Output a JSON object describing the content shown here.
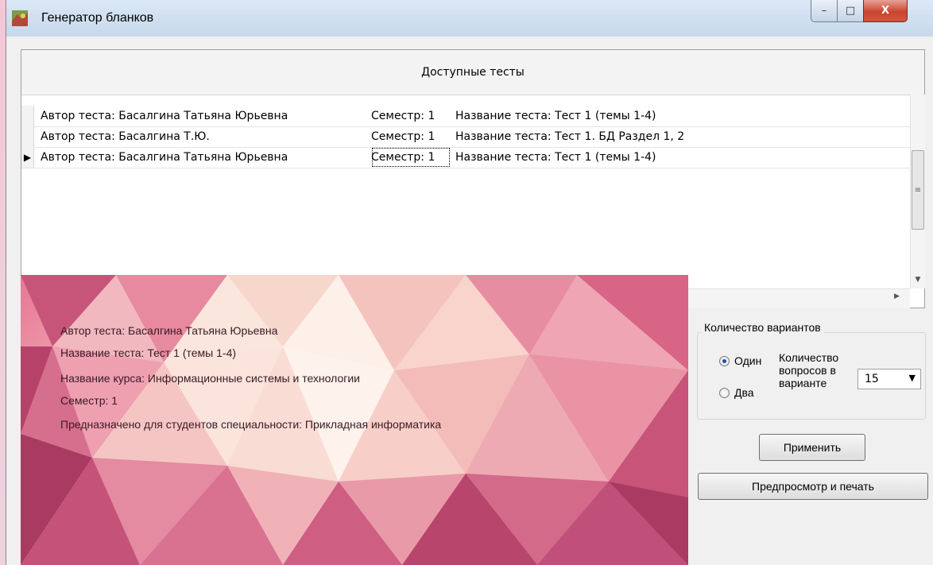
{
  "window": {
    "title": "Генератор бланков",
    "controls": {
      "minimize": "–",
      "maximize": "□",
      "close": "X"
    }
  },
  "tests_grid": {
    "caption": "Доступные тесты",
    "rows": [
      {
        "author": "Автор теста: Басалгина Татьяна Юрьевна",
        "semester": "Семестр: 1",
        "title": "Название теста: Тест 1 (темы 1-4)",
        "marker": ""
      },
      {
        "author": "Автор теста: Басалгина Т.Ю.",
        "semester": "Семестр: 1",
        "title": "Название теста:  Тест 1. БД Раздел 1, 2",
        "marker": ""
      },
      {
        "author": "Автор теста: Басалгина Татьяна Юрьевна",
        "semester": "Семестр: 1",
        "title": "Название теста: Тест 1 (темы 1-4)",
        "marker": "▶"
      }
    ]
  },
  "details": {
    "author": "Автор теста: Басалгина Татьяна Юрьевна",
    "test_name": "Название теста: Тест 1 (темы 1-4)",
    "course": "Название курса:  Информационные системы и технологии",
    "semester": "Семестр: 1",
    "audience": "Предназначено для студентов специальности: Прикладная информатика"
  },
  "variants": {
    "group_title": "Количество вариантов",
    "option_one": "Один",
    "option_two": "Два",
    "selected": "Один",
    "questions_label": "Количество вопросов в варианте",
    "questions_value": "15"
  },
  "buttons": {
    "apply": "Применить",
    "preview": "Предпросмотр и печать"
  },
  "colors": {
    "accent": "#1a4fae",
    "close_button": "#c8452f"
  }
}
